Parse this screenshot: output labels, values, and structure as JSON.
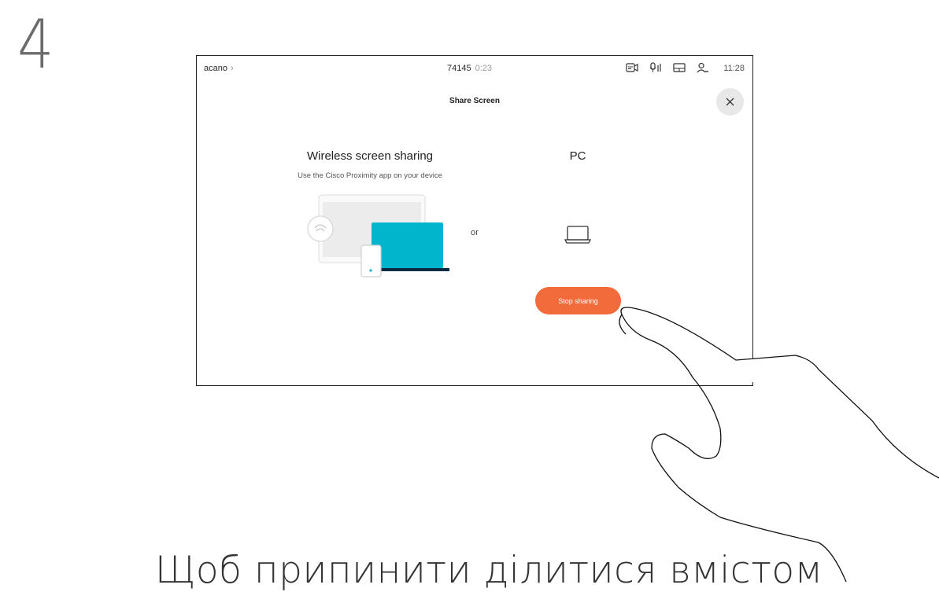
{
  "step": {
    "number": "4"
  },
  "status_bar": {
    "breadcrumb": "acano",
    "call_number": "74145",
    "call_timer": "0:23",
    "icons": [
      "camera-icon",
      "microphone-icon",
      "display-icon",
      "participants-icon"
    ],
    "clock": "11:28"
  },
  "panel": {
    "title": "Share Screen",
    "close_icon": "close-icon"
  },
  "wireless": {
    "heading": "Wireless screen sharing",
    "subtext": "Use the Cisco Proximity app on your device"
  },
  "or_label": "or",
  "pc": {
    "heading": "PC",
    "icon": "laptop-icon"
  },
  "stop_button": {
    "label": "Stop sharing",
    "color": "#f26b3a"
  },
  "caption": "Щоб припинити ділитися вмістом",
  "colors": {
    "accent": "#f26b3a",
    "laptop_screen": "#00b5cc"
  }
}
